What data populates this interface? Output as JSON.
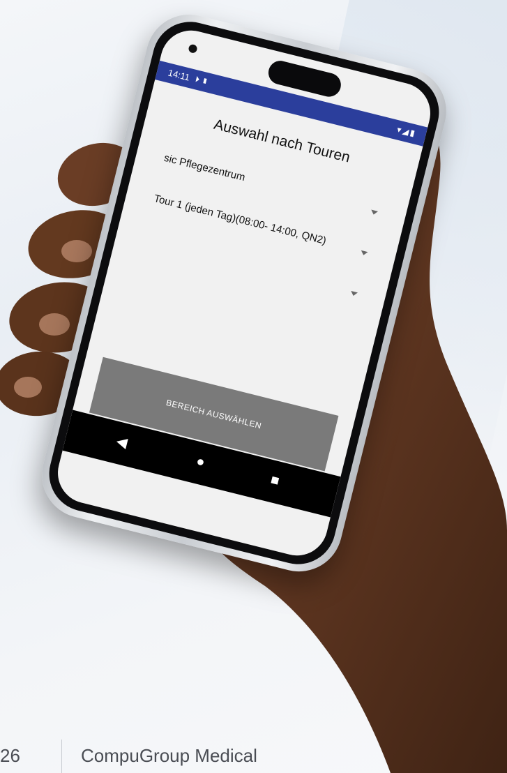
{
  "phone": {
    "status_time": "14:11",
    "status_left_icons": "⏵ ▮",
    "status_right_icons": "▾◢▮"
  },
  "app": {
    "title": "Auswahl nach Touren",
    "dropdowns": [
      {
        "value": "sic Pflegezentrum"
      },
      {
        "value": "Tour 1 (jeden Tag)(08:00- 14:00, QN2)"
      },
      {
        "value": ""
      }
    ],
    "action_button": "BEREICH AUSWÄHLEN"
  },
  "navbar": {
    "back_icon": "◀",
    "home_icon": "●",
    "recent_icon": "■"
  },
  "footer": {
    "year_fragment": "26",
    "brand": "CompuGroup Medical"
  },
  "colors": {
    "statusbar": "#2b3e9c",
    "button": "#7a7a7a"
  }
}
